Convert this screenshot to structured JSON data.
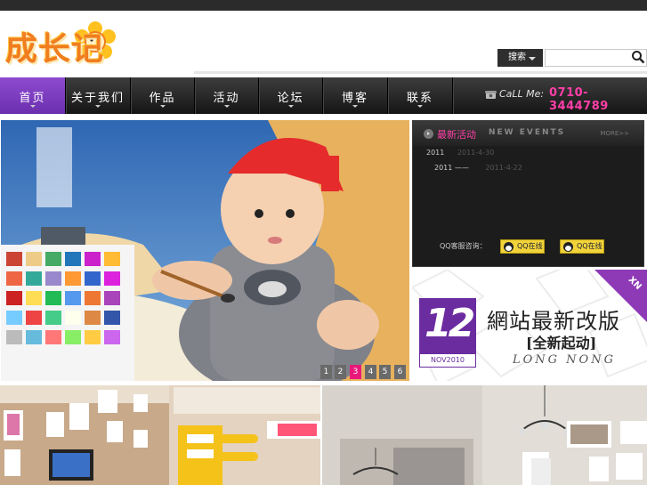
{
  "logo": {
    "text": "成长记"
  },
  "search": {
    "button_label": "搜索",
    "placeholder": ""
  },
  "nav": {
    "items": [
      {
        "label": "首页"
      },
      {
        "label": "关于我们"
      },
      {
        "label": "作品"
      },
      {
        "label": "活动"
      },
      {
        "label": "论坛"
      },
      {
        "label": "博客"
      },
      {
        "label": "联系"
      }
    ],
    "call_label": "CaLL Me:",
    "phone": "0710-3444789"
  },
  "slider": {
    "numbers": [
      "1",
      "2",
      "3",
      "4",
      "5",
      "6"
    ],
    "active_index": 2
  },
  "news": {
    "title": "最新活动",
    "subtitle": "NEW EVENTS",
    "more": "MORE>>",
    "items": [
      {
        "year": "2011",
        "date": "2011-4-30"
      },
      {
        "year": "2011 ——",
        "date": "2011-4-22"
      }
    ],
    "qq_label": "QQ客服咨询：",
    "qq_buttons": [
      "QQ在线",
      "QQ在线"
    ]
  },
  "promo": {
    "number": "12",
    "date": "NOV2010",
    "title": "網站最新改版",
    "subtitle": "[全新起动]",
    "english": "LONG NONG",
    "corner": "XN"
  },
  "colors": {
    "accent_purple": "#7b36bf",
    "pink": "#e8197b",
    "nav_dark": "#1f1f1f",
    "logo_orange": "#f07d1f"
  },
  "icons": [
    "search-icon",
    "phone-icon",
    "play-circle-icon",
    "qq-penguin-icon",
    "chevron-down-icon"
  ]
}
